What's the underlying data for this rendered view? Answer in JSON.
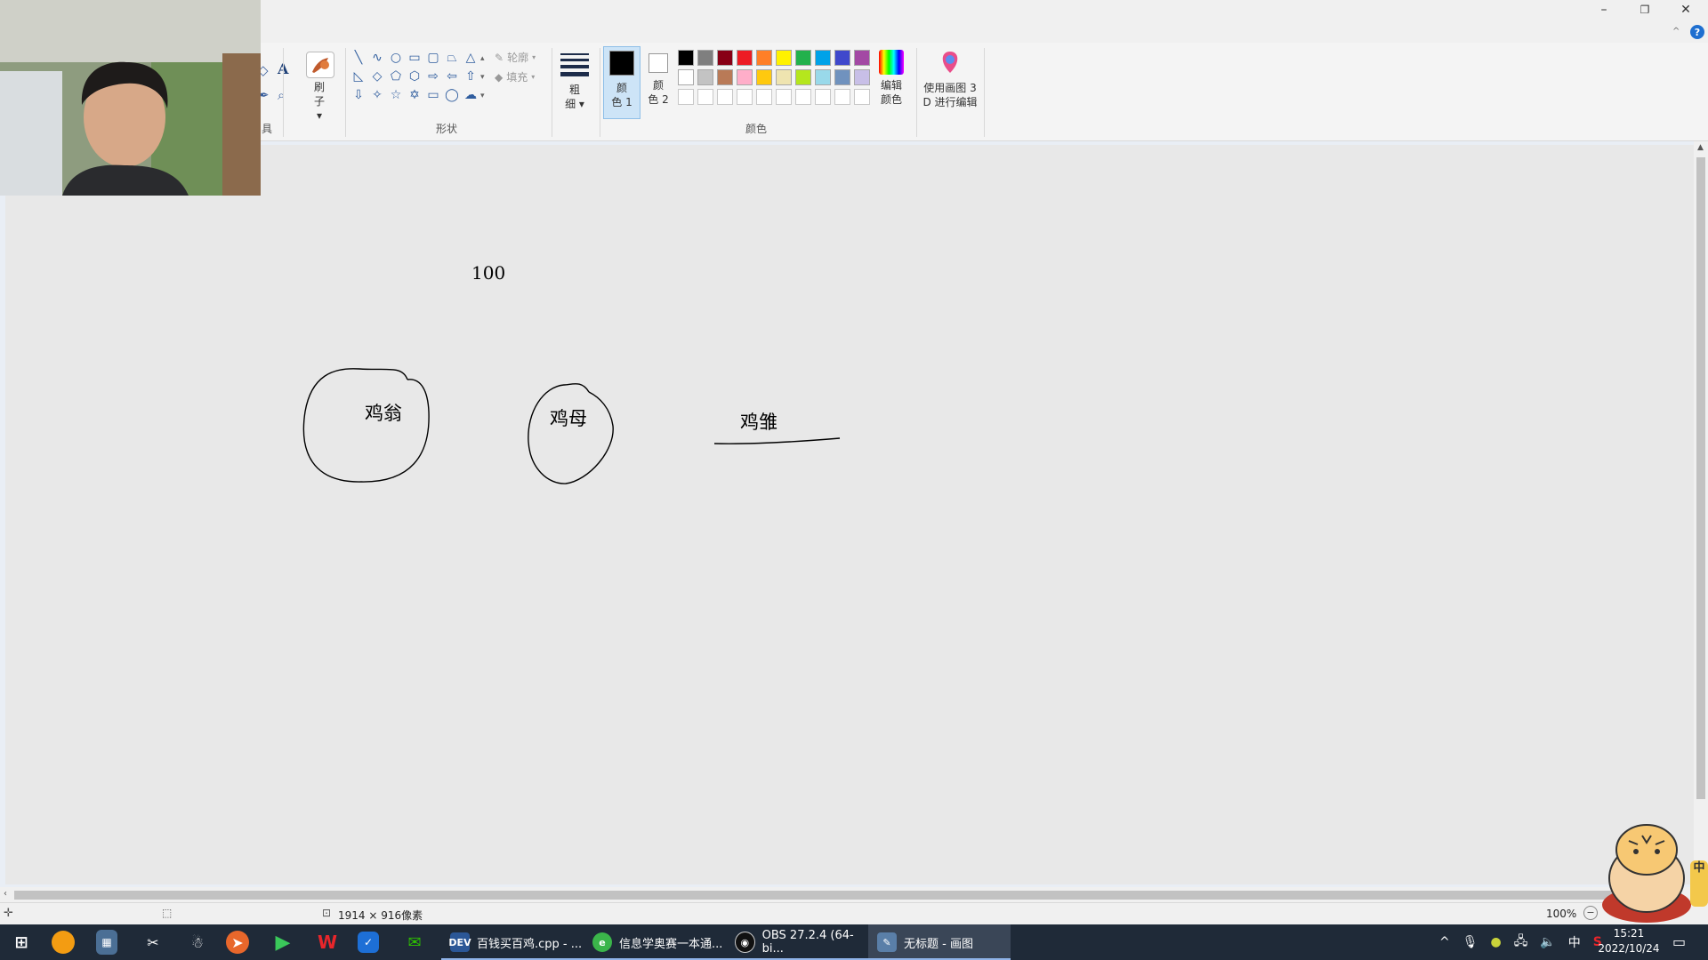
{
  "window": {
    "minimize_glyph": "–",
    "restore_glyph": "❐",
    "close_glyph": "✕",
    "help_glyph": "?"
  },
  "ribbon": {
    "tools_label_partial": "具",
    "text_tool_glyph": "A",
    "brush_label_line1": "刷",
    "brush_label_line2": "子",
    "shapes_label": "形状",
    "outline_label": "轮廓",
    "fill_label": "填充",
    "size_label_line1": "粗",
    "size_label_line2": "细",
    "color1_label_line1": "颜",
    "color1_label_line2": "色 1",
    "color2_label_line1": "颜",
    "color2_label_line2": "色 2",
    "colors_group_label": "颜色",
    "edit_colors_line1": "编辑",
    "edit_colors_line2": "颜色",
    "paint3d_line1": "使用画图 3",
    "paint3d_line2": "D 进行编辑",
    "palette_row1": [
      "#000000",
      "#7f7f7f",
      "#880015",
      "#ed1c24",
      "#ff7f27",
      "#fff200",
      "#22b14c",
      "#00a2e8",
      "#3f48cc",
      "#a349a4"
    ],
    "palette_row2": [
      "#ffffff",
      "#c3c3c3",
      "#b97a57",
      "#ffaec9",
      "#ffc90e",
      "#efe4b0",
      "#b5e61d",
      "#99d9ea",
      "#7092be",
      "#c8bfe7"
    ],
    "color1": "#000000",
    "color2": "#ffffff"
  },
  "canvas": {
    "text_100": "100",
    "label_rooster": "鸡翁",
    "label_hen": "鸡母",
    "label_chick": "鸡雏"
  },
  "statusbar": {
    "dimensions": "1914 × 916像素",
    "zoom": "100%"
  },
  "taskbar": {
    "apps": [
      {
        "label": "百钱买百鸡.cpp - ...",
        "icon_text": "DEV",
        "color": "#2b5797"
      },
      {
        "label": "信息学奥赛一本通...",
        "icon_text": "e",
        "color": "#3bb54a"
      },
      {
        "label": "OBS 27.2.4 (64-bi...",
        "icon_text": "◉",
        "color": "#222222"
      },
      {
        "label": "无标题 - 画图",
        "icon_text": "✎",
        "color": "#5a7fa8"
      }
    ],
    "ime": "中",
    "time": "15:21",
    "date": "2022/10/24"
  }
}
